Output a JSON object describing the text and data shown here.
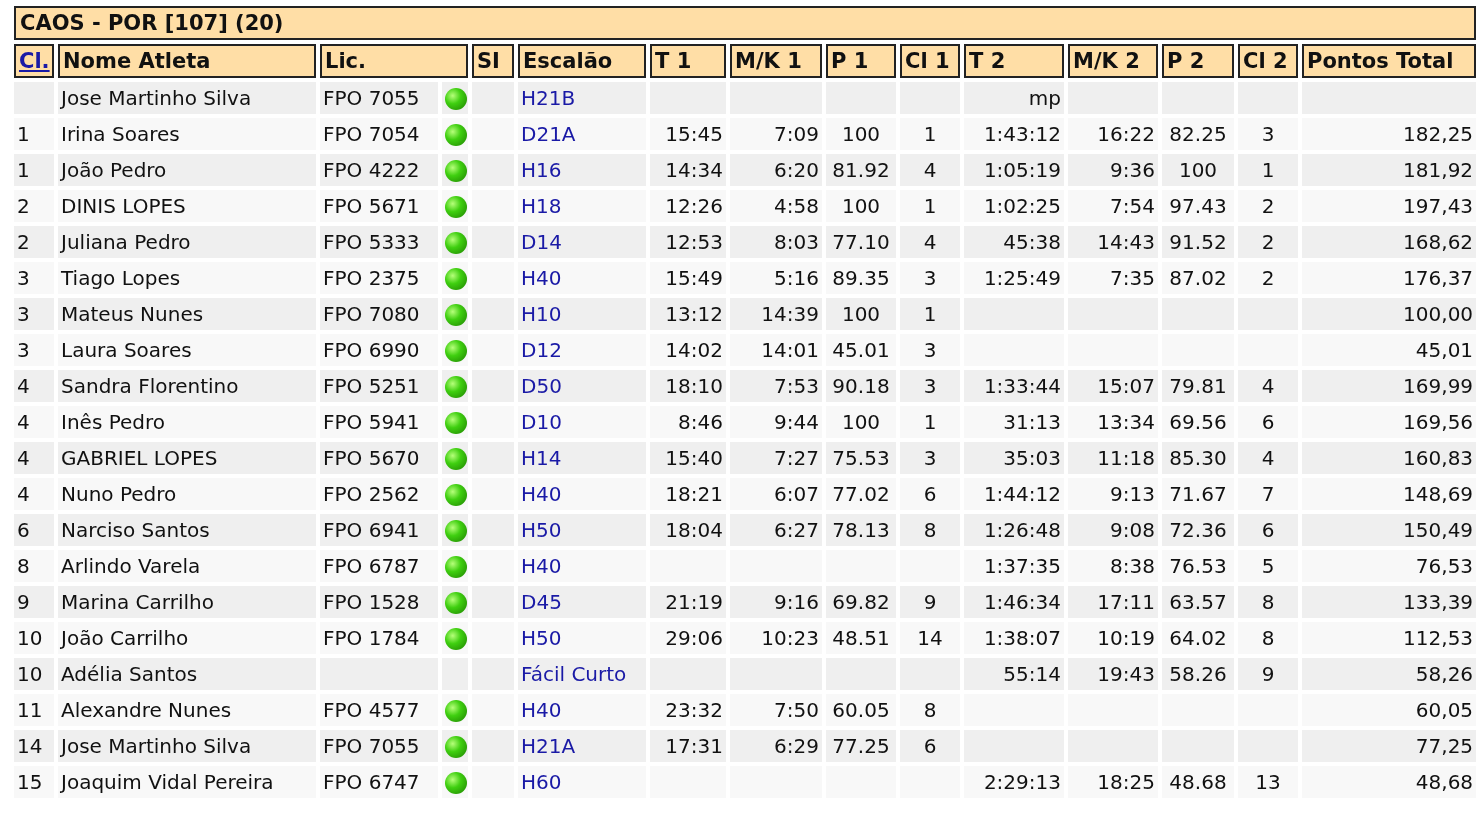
{
  "title": "CAOS - POR [107] (20)",
  "columns": [
    {
      "label": "Cl.",
      "kind": "link"
    },
    {
      "label": "Nome Atleta",
      "kind": "text"
    },
    {
      "label": "Lic.",
      "kind": "wide"
    },
    {
      "label": "SI",
      "kind": "text"
    },
    {
      "label": "Escalão",
      "kind": "text"
    },
    {
      "label": "T 1",
      "kind": "text"
    },
    {
      "label": "M/K 1",
      "kind": "text"
    },
    {
      "label": "P 1",
      "kind": "text"
    },
    {
      "label": "Cl 1",
      "kind": "text"
    },
    {
      "label": "T 2",
      "kind": "text"
    },
    {
      "label": "M/K 2",
      "kind": "text"
    },
    {
      "label": "P 2",
      "kind": "text"
    },
    {
      "label": "Cl 2",
      "kind": "text"
    },
    {
      "label": "Pontos Total",
      "kind": "text"
    }
  ],
  "rows": [
    {
      "name": "Jose Martinho Silva",
      "lic": "FPO 7055",
      "si": true,
      "class": "H21B",
      "t2": "mp"
    },
    {
      "cl": "1",
      "name": "Irina Soares",
      "lic": "FPO 7054",
      "si": true,
      "class": "D21A",
      "t1": "15:45",
      "mk1": "7:09",
      "p1": "100",
      "cl1": "1",
      "t2": "1:43:12",
      "mk2": "16:22",
      "p2": "82.25",
      "cl2": "3",
      "total": "182,25"
    },
    {
      "cl": "1",
      "name": "João Pedro",
      "lic": "FPO 4222",
      "si": true,
      "class": "H16",
      "t1": "14:34",
      "mk1": "6:20",
      "p1": "81.92",
      "cl1": "4",
      "t2": "1:05:19",
      "mk2": "9:36",
      "p2": "100",
      "cl2": "1",
      "total": "181,92"
    },
    {
      "cl": "2",
      "name": "DINIS LOPES",
      "lic": "FPO 5671",
      "si": true,
      "class": "H18",
      "t1": "12:26",
      "mk1": "4:58",
      "p1": "100",
      "cl1": "1",
      "t2": "1:02:25",
      "mk2": "7:54",
      "p2": "97.43",
      "cl2": "2",
      "total": "197,43"
    },
    {
      "cl": "2",
      "name": "Juliana Pedro",
      "lic": "FPO 5333",
      "si": true,
      "class": "D14",
      "t1": "12:53",
      "mk1": "8:03",
      "p1": "77.10",
      "cl1": "4",
      "t2": "45:38",
      "mk2": "14:43",
      "p2": "91.52",
      "cl2": "2",
      "total": "168,62"
    },
    {
      "cl": "3",
      "name": "Tiago Lopes",
      "lic": "FPO 2375",
      "si": true,
      "class": "H40",
      "t1": "15:49",
      "mk1": "5:16",
      "p1": "89.35",
      "cl1": "3",
      "t2": "1:25:49",
      "mk2": "7:35",
      "p2": "87.02",
      "cl2": "2",
      "total": "176,37"
    },
    {
      "cl": "3",
      "name": "Mateus Nunes",
      "lic": "FPO 7080",
      "si": true,
      "class": "H10",
      "t1": "13:12",
      "mk1": "14:39",
      "p1": "100",
      "cl1": "1",
      "total": "100,00"
    },
    {
      "cl": "3",
      "name": "Laura Soares",
      "lic": "FPO 6990",
      "si": true,
      "class": "D12",
      "t1": "14:02",
      "mk1": "14:01",
      "p1": "45.01",
      "cl1": "3",
      "total": "45,01"
    },
    {
      "cl": "4",
      "name": "Sandra Florentino",
      "lic": "FPO 5251",
      "si": true,
      "class": "D50",
      "t1": "18:10",
      "mk1": "7:53",
      "p1": "90.18",
      "cl1": "3",
      "t2": "1:33:44",
      "mk2": "15:07",
      "p2": "79.81",
      "cl2": "4",
      "total": "169,99"
    },
    {
      "cl": "4",
      "name": "Inês Pedro",
      "lic": "FPO 5941",
      "si": true,
      "class": "D10",
      "t1": "8:46",
      "mk1": "9:44",
      "p1": "100",
      "cl1": "1",
      "t2": "31:13",
      "mk2": "13:34",
      "p2": "69.56",
      "cl2": "6",
      "total": "169,56"
    },
    {
      "cl": "4",
      "name": "GABRIEL LOPES",
      "lic": "FPO 5670",
      "si": true,
      "class": "H14",
      "t1": "15:40",
      "mk1": "7:27",
      "p1": "75.53",
      "cl1": "3",
      "t2": "35:03",
      "mk2": "11:18",
      "p2": "85.30",
      "cl2": "4",
      "total": "160,83"
    },
    {
      "cl": "4",
      "name": "Nuno Pedro",
      "lic": "FPO 2562",
      "si": true,
      "class": "H40",
      "t1": "18:21",
      "mk1": "6:07",
      "p1": "77.02",
      "cl1": "6",
      "t2": "1:44:12",
      "mk2": "9:13",
      "p2": "71.67",
      "cl2": "7",
      "total": "148,69"
    },
    {
      "cl": "6",
      "name": "Narciso Santos",
      "lic": "FPO 6941",
      "si": true,
      "class": "H50",
      "t1": "18:04",
      "mk1": "6:27",
      "p1": "78.13",
      "cl1": "8",
      "t2": "1:26:48",
      "mk2": "9:08",
      "p2": "72.36",
      "cl2": "6",
      "total": "150,49"
    },
    {
      "cl": "8",
      "name": "Arlindo Varela",
      "lic": "FPO 6787",
      "si": true,
      "class": "H40",
      "t2": "1:37:35",
      "mk2": "8:38",
      "p2": "76.53",
      "cl2": "5",
      "total": "76,53"
    },
    {
      "cl": "9",
      "name": "Marina Carrilho",
      "lic": "FPO 1528",
      "si": true,
      "class": "D45",
      "t1": "21:19",
      "mk1": "9:16",
      "p1": "69.82",
      "cl1": "9",
      "t2": "1:46:34",
      "mk2": "17:11",
      "p2": "63.57",
      "cl2": "8",
      "total": "133,39"
    },
    {
      "cl": "10",
      "name": "João Carrilho",
      "lic": "FPO 1784",
      "si": true,
      "class": "H50",
      "t1": "29:06",
      "mk1": "10:23",
      "p1": "48.51",
      "cl1": "14",
      "t2": "1:38:07",
      "mk2": "10:19",
      "p2": "64.02",
      "cl2": "8",
      "total": "112,53"
    },
    {
      "cl": "10",
      "name": "Adélia Santos",
      "si": false,
      "class": "Fácil Curto",
      "t2": "55:14",
      "mk2": "19:43",
      "p2": "58.26",
      "cl2": "9",
      "total": "58,26"
    },
    {
      "cl": "11",
      "name": "Alexandre Nunes",
      "lic": "FPO 4577",
      "si": true,
      "class": "H40",
      "t1": "23:32",
      "mk1": "7:50",
      "p1": "60.05",
      "cl1": "8",
      "total": "60,05"
    },
    {
      "cl": "14",
      "name": "Jose Martinho Silva",
      "lic": "FPO 7055",
      "si": true,
      "class": "H21A",
      "t1": "17:31",
      "mk1": "6:29",
      "p1": "77.25",
      "cl1": "6",
      "total": "77,25"
    },
    {
      "cl": "15",
      "name": "Joaquim Vidal Pereira",
      "lic": "FPO 6747",
      "si": true,
      "class": "H60",
      "t2": "2:29:13",
      "mk2": "18:25",
      "p2": "48.68",
      "cl2": "13",
      "total": "48,68"
    }
  ]
}
